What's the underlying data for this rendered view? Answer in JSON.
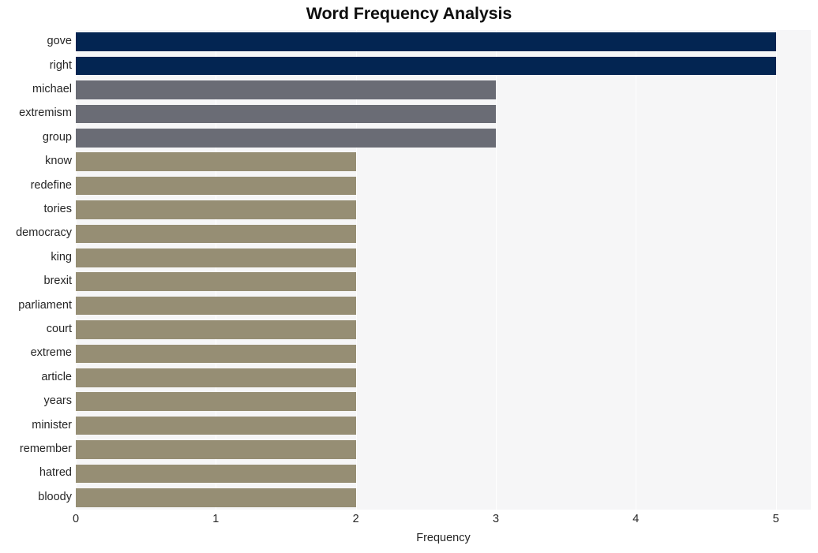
{
  "chart_data": {
    "type": "bar",
    "orientation": "horizontal",
    "title": "Word Frequency Analysis",
    "xlabel": "Frequency",
    "ylabel": "",
    "xlim": [
      0,
      5.25
    ],
    "xticks": [
      0,
      1,
      2,
      3,
      4,
      5
    ],
    "xtick_labels": [
      "0",
      "1",
      "2",
      "3",
      "4",
      "5"
    ],
    "grid": "vertical-white",
    "legend": "none",
    "categories": [
      "gove",
      "right",
      "michael",
      "extremism",
      "group",
      "know",
      "redefine",
      "tories",
      "democracy",
      "king",
      "brexit",
      "parliament",
      "court",
      "extreme",
      "article",
      "years",
      "minister",
      "remember",
      "hatred",
      "bloody"
    ],
    "values": [
      5,
      5,
      3,
      3,
      3,
      2,
      2,
      2,
      2,
      2,
      2,
      2,
      2,
      2,
      2,
      2,
      2,
      2,
      2,
      2
    ],
    "bar_colors": [
      "#032552",
      "#032552",
      "#6a6c75",
      "#6a6c75",
      "#6a6c75",
      "#968e74",
      "#968e74",
      "#968e74",
      "#968e74",
      "#968e74",
      "#968e74",
      "#968e74",
      "#968e74",
      "#968e74",
      "#968e74",
      "#968e74",
      "#968e74",
      "#968e74",
      "#968e74",
      "#968e74"
    ],
    "colors": {
      "plot_background": "#f6f6f7",
      "figure_background": "#ffffff",
      "gridline": "#ffffff",
      "text": "#262626",
      "title": "#0e0e0e",
      "high_value_bar": "#032552",
      "mid_value_bar": "#6a6c75",
      "low_value_bar": "#968e74"
    }
  }
}
